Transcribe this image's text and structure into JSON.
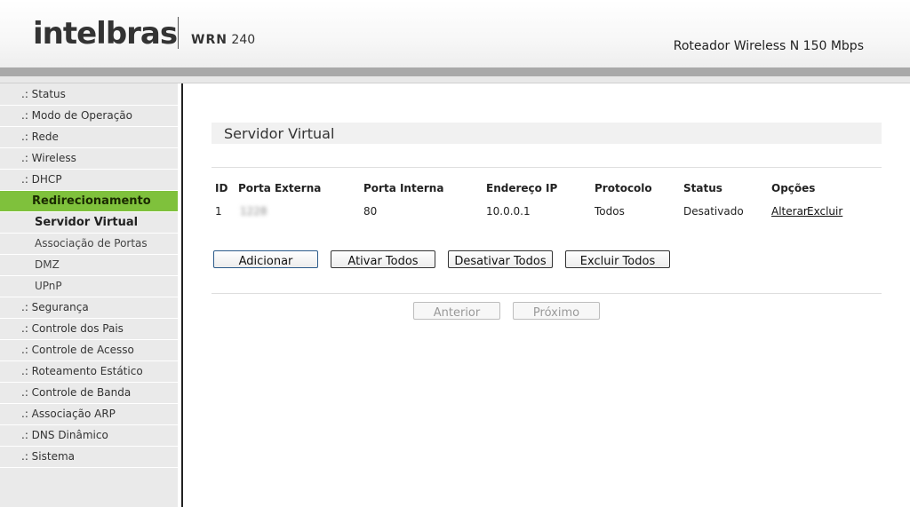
{
  "header": {
    "brand": "intelbras",
    "model_prefix": "WRN",
    "model_number": "240",
    "product_name": "Roteador Wireless N 150 Mbps"
  },
  "sidebar": {
    "items": [
      {
        "label": ".: Status"
      },
      {
        "label": ".: Modo de Operação"
      },
      {
        "label": ".: Rede"
      },
      {
        "label": ".: Wireless"
      },
      {
        "label": ".: DHCP"
      },
      {
        "label": "Redirecionamento"
      },
      {
        "label": "Servidor Virtual"
      },
      {
        "label": "Associação de Portas"
      },
      {
        "label": "DMZ"
      },
      {
        "label": "UPnP"
      },
      {
        "label": ".: Segurança"
      },
      {
        "label": ".: Controle dos Pais"
      },
      {
        "label": ".: Controle de Acesso"
      },
      {
        "label": ".: Roteamento Estático"
      },
      {
        "label": ".: Controle de Banda"
      },
      {
        "label": ".: Associação ARP"
      },
      {
        "label": ".: DNS Dinâmico"
      },
      {
        "label": ".: Sistema"
      }
    ]
  },
  "main": {
    "title": "Servidor Virtual",
    "table": {
      "headers": [
        "ID",
        "Porta Externa",
        "Porta Interna",
        "Endereço IP",
        "Protocolo",
        "Status",
        "Opções"
      ],
      "rows": [
        {
          "id": "1",
          "external_port": "1228",
          "internal_port": "80",
          "ip": "10.0.0.1",
          "protocol": "Todos",
          "status": "Desativado",
          "edit": "Alterar",
          "delete": "Excluir"
        }
      ]
    },
    "buttons": {
      "add": "Adicionar",
      "enable_all": "Ativar Todos",
      "disable_all": "Desativar Todos",
      "delete_all": "Excluir Todos"
    },
    "pagination": {
      "previous": "Anterior",
      "next": "Próximo"
    }
  }
}
